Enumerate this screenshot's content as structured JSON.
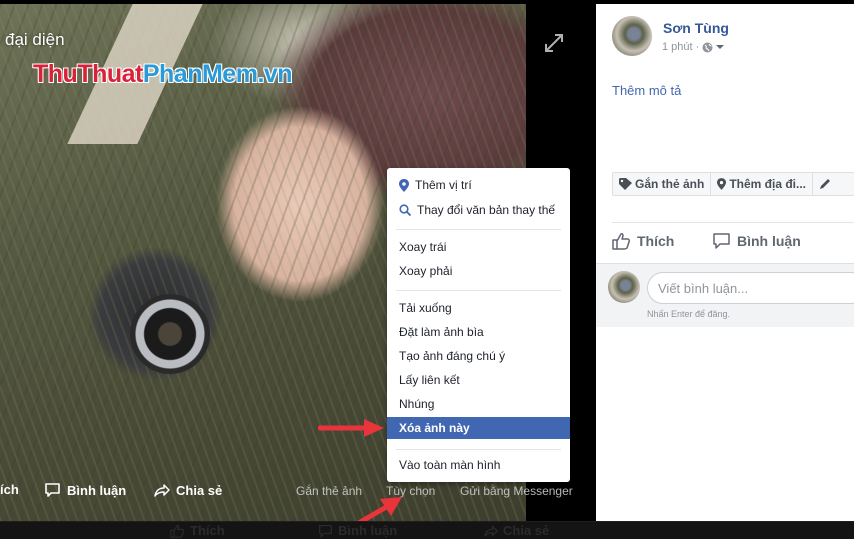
{
  "viewer": {
    "album_title": "đại diện",
    "watermark_part1": "ThuThuat",
    "watermark_part2": "PhanMem.vn",
    "actions": {
      "like": "ích",
      "comment": "Bình luận",
      "share": "Chia sẻ",
      "tag_photo": "Gắn thẻ ảnh",
      "options": "Tùy chọn",
      "send_messenger": "Gửi bằng Messenger"
    }
  },
  "options_menu": {
    "items": [
      {
        "label": "Thêm vị trí",
        "icon": "location-pin-icon"
      },
      {
        "label": "Thay đổi văn bản thay thế",
        "icon": "search-icon"
      },
      {
        "label": "Xoay trái"
      },
      {
        "label": "Xoay phải"
      },
      {
        "label": "Tải xuống"
      },
      {
        "label": "Đặt làm ảnh bìa"
      },
      {
        "label": "Tạo ảnh đáng chú ý"
      },
      {
        "label": "Lấy liên kết"
      },
      {
        "label": "Nhúng"
      },
      {
        "label": "Xóa ảnh này",
        "selected": true
      },
      {
        "label": "Vào toàn màn hình"
      }
    ]
  },
  "sidebar": {
    "author": "Sơn Tùng",
    "time": "1 phút",
    "privacy_icon": "globe-icon",
    "add_description": "Thêm mô tả",
    "tag_buttons": [
      "Gắn thẻ ảnh",
      "Thêm địa đi...",
      ""
    ],
    "like": "Thích",
    "comment": "Bình luận",
    "comment_placeholder": "Viết bình luận...",
    "comment_hint": "Nhấn Enter để đăng."
  },
  "bottom_strip": {
    "like": "Thích",
    "comment": "Bình luận",
    "share": "Chia sẻ"
  },
  "colors": {
    "selected_bg": "#4267b2",
    "link": "#365899",
    "annotation_arrow": "#e8343a"
  }
}
